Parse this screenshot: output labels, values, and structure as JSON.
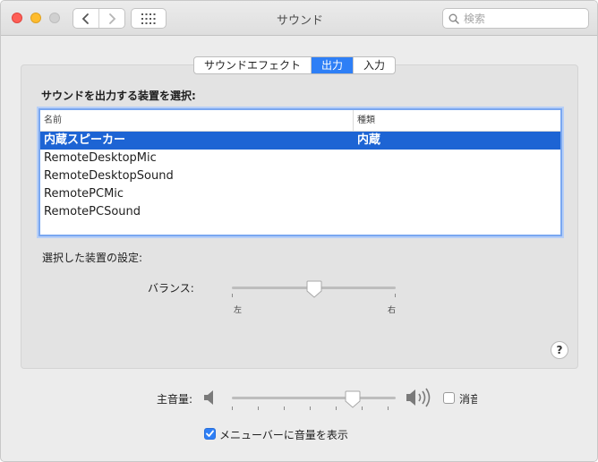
{
  "window": {
    "title": "サウンド"
  },
  "search": {
    "placeholder": "検索"
  },
  "icons": {
    "back": "chevron-left-icon",
    "forward": "chevron-right-icon",
    "show_all": "grid-icon",
    "search": "magnifier-icon",
    "volume_low": "speaker-low-icon",
    "volume_high": "speaker-high-icon"
  },
  "colors": {
    "accent": "#2e7ff6",
    "selection": "#1d64d4"
  },
  "tabs": [
    {
      "label": "サウンドエフェクト",
      "active": false
    },
    {
      "label": "出力",
      "active": true
    },
    {
      "label": "入力",
      "active": false
    }
  ],
  "output": {
    "select_label": "サウンドを出力する装置を選択:",
    "columns": {
      "name": "名前",
      "type": "種類"
    },
    "devices": [
      {
        "name": "内蔵スピーカー",
        "type": "内蔵",
        "selected": true
      },
      {
        "name": "RemoteDesktopMic",
        "type": "",
        "selected": false
      },
      {
        "name": "RemoteDesktopSound",
        "type": "",
        "selected": false
      },
      {
        "name": "RemotePCMic",
        "type": "",
        "selected": false
      },
      {
        "name": "RemotePCSound",
        "type": "",
        "selected": false
      }
    ],
    "settings_label": "選択した装置の設定:",
    "balance": {
      "label": "バランス:",
      "left": "左",
      "right": "右",
      "value": 0.5
    }
  },
  "help": "?",
  "volume": {
    "label": "主音量:",
    "value": 0.74,
    "mute_label": "消音",
    "muted": false
  },
  "menubar_option": {
    "label": "メニューバーに音量を表示",
    "checked": true
  }
}
